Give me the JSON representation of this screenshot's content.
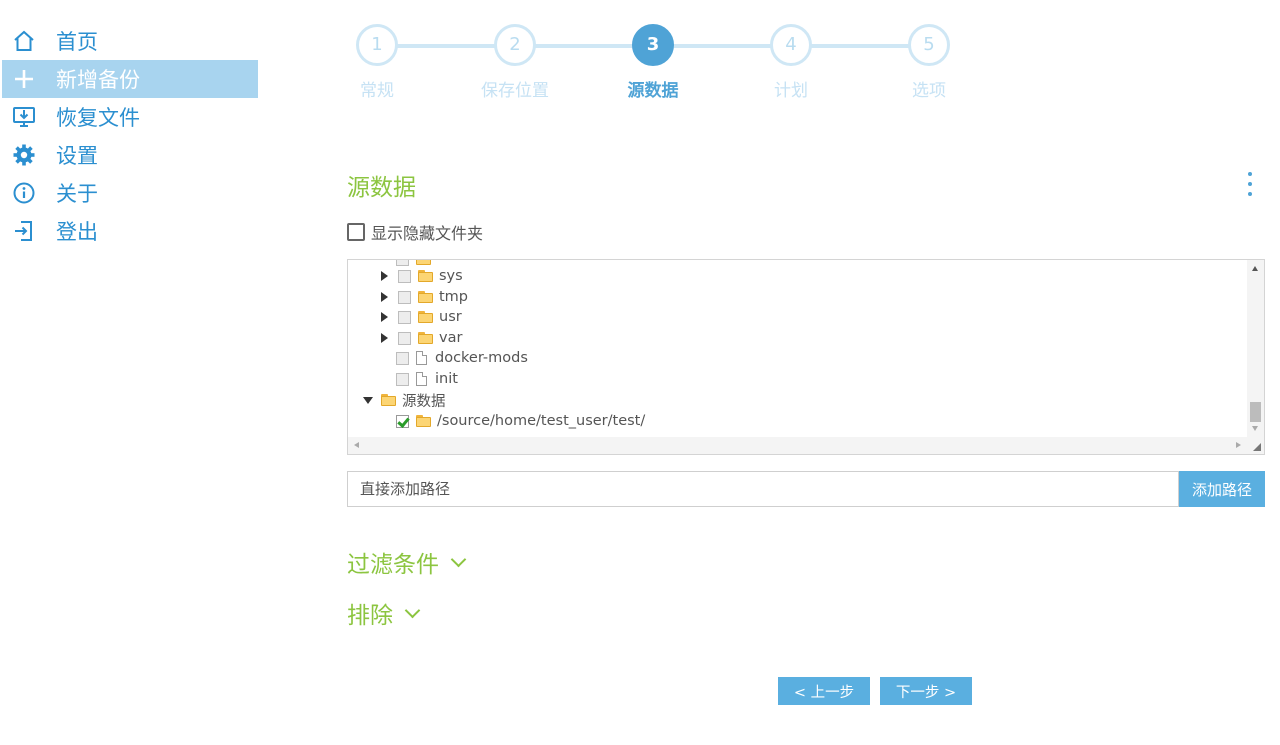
{
  "sidebar": {
    "items": [
      {
        "label": "首页",
        "icon": "home-icon",
        "active": false
      },
      {
        "label": "新增备份",
        "icon": "plus-icon",
        "active": true
      },
      {
        "label": "恢复文件",
        "icon": "restore-icon",
        "active": false
      },
      {
        "label": "设置",
        "icon": "gear-icon",
        "active": false
      },
      {
        "label": "关于",
        "icon": "info-icon",
        "active": false
      },
      {
        "label": "登出",
        "icon": "logout-icon",
        "active": false
      }
    ]
  },
  "stepper": {
    "steps": [
      {
        "number": "1",
        "label": "常规"
      },
      {
        "number": "2",
        "label": "保存位置"
      },
      {
        "number": "3",
        "label": "源数据"
      },
      {
        "number": "4",
        "label": "计划"
      },
      {
        "number": "5",
        "label": "选项"
      }
    ],
    "active_step": 3
  },
  "section": {
    "title": "源数据",
    "show_hidden_label": "显示隐藏文件夹"
  },
  "tree": {
    "rows": [
      {
        "label": "sys",
        "type": "folder",
        "expandable": true,
        "checked": false
      },
      {
        "label": "tmp",
        "type": "folder",
        "expandable": true,
        "checked": false
      },
      {
        "label": "usr",
        "type": "folder",
        "expandable": true,
        "checked": false
      },
      {
        "label": "var",
        "type": "folder",
        "expandable": true,
        "checked": false
      },
      {
        "label": "docker-mods",
        "type": "file",
        "expandable": false,
        "checked": false
      },
      {
        "label": "init",
        "type": "file",
        "expandable": false,
        "checked": false
      },
      {
        "label": "源数据",
        "type": "root-folder",
        "expandable": true,
        "checked": false
      },
      {
        "label": "/source/home/test_user/test/",
        "type": "folder",
        "expandable": false,
        "checked": true
      }
    ]
  },
  "path": {
    "placeholder": "直接添加路径",
    "add_label": "添加路径"
  },
  "filters": {
    "filter_label": "过滤条件",
    "exclude_label": "排除"
  },
  "footer": {
    "prev_label": "< 上一步",
    "next_label": "下一步 >"
  },
  "colors": {
    "accent_blue": "#4fa3d6",
    "accent_green": "#8cc540",
    "sidebar_active": "#a8d4ef"
  }
}
